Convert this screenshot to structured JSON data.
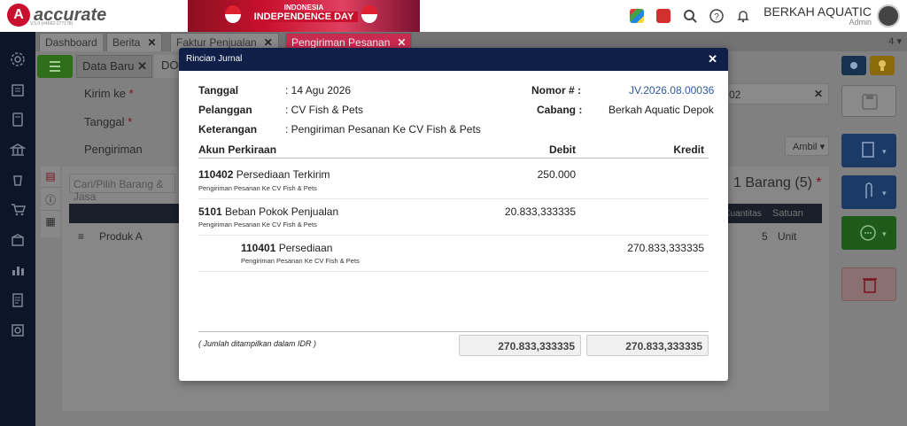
{
  "app": {
    "logo_letter": "A",
    "logo_text": "accurate",
    "logo_sub": "V.5.0 (#4662-277178)"
  },
  "banner": {
    "line1": "INDONESIA",
    "line2": "INDEPENDENCE DAY"
  },
  "user": {
    "company": "BERKAH AQUATIC",
    "role": "Admin"
  },
  "tabs": [
    {
      "label": "Dashboard"
    },
    {
      "label": "Berita"
    },
    {
      "label": "Faktur Penjualan"
    },
    {
      "label": "Pengiriman Pesanan"
    }
  ],
  "tab_count": "4",
  "subtabs": {
    "data_baru": "Data Baru",
    "do": "DO"
  },
  "form": {
    "kirim_ke": "Kirim ke",
    "tanggal": "Tanggal",
    "pengiriman": "Pengiriman",
    "required": "*",
    "search_placeholder": "Cari/Pilih Barang & Jasa",
    "barang_count": "1 Barang (5)",
    "ambil": "Ambil",
    "col_kuantitas": "Kuantitas",
    "col_satuan": "Satuan",
    "row_item": "Produk A",
    "row_qty": "5",
    "row_unit": "Unit",
    "right_field": "02"
  },
  "modal": {
    "title": "Rincian Jurnal",
    "tanggal_label": "Tanggal",
    "tanggal_value": ": 14 Agu 2026",
    "pelanggan_label": "Pelanggan",
    "pelanggan_value": ": CV Fish & Pets",
    "keterangan_label": "Keterangan",
    "keterangan_value": ": Pengiriman Pesanan Ke CV Fish & Pets",
    "nomor_label": "Nomor # :",
    "nomor_value": "JV.2026.08.00036",
    "cabang_label": "Cabang :",
    "cabang_value": "Berkah Aquatic Depok",
    "col_akun": "Akun Perkiraan",
    "col_debit": "Debit",
    "col_kredit": "Kredit",
    "entries": [
      {
        "code": "110402",
        "name": "Persediaan Terkirim",
        "note": "Pengiriman Pesanan Ke CV Fish & Pets",
        "debit": "250.000",
        "kredit": ""
      },
      {
        "code": "5101",
        "name": "Beban Pokok Penjualan",
        "note": "Pengiriman Pesanan Ke CV Fish & Pets",
        "debit": "20.833,333335",
        "kredit": ""
      },
      {
        "code": "110401",
        "name": "Persediaan",
        "note": "Pengiriman Pesanan Ke CV Fish & Pets",
        "debit": "",
        "kredit": "270.833,333335"
      }
    ],
    "footer_note": "( Jumlah ditampilkan dalam IDR )",
    "total_debit": "270.833,333335",
    "total_kredit": "270.833,333335"
  },
  "colors": {
    "accent": "#c92a4f",
    "modal_header": "#0f1f48",
    "nomor": "#2d5aa0"
  }
}
